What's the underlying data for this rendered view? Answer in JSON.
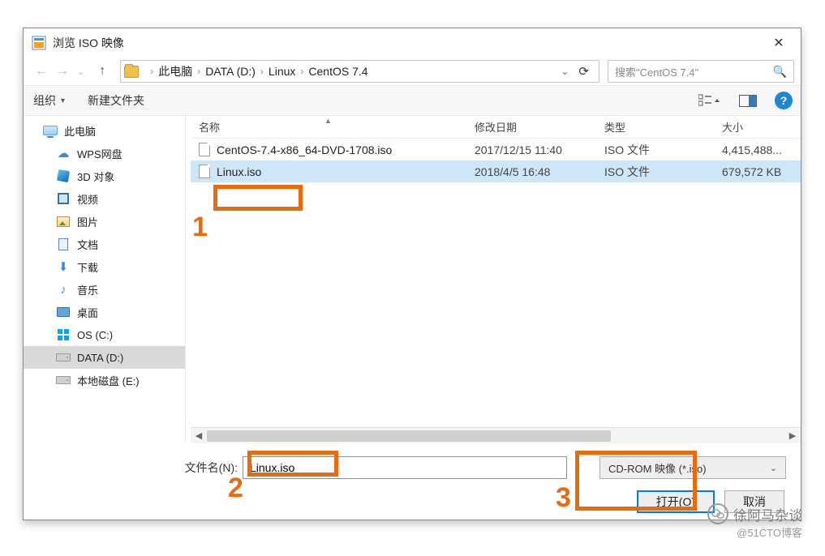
{
  "title": "浏览 ISO 映像",
  "breadcrumb": {
    "parts": [
      "此电脑",
      "DATA (D:)",
      "Linux",
      "CentOS 7.4"
    ]
  },
  "search": {
    "placeholder": "搜索\"CentOS 7.4\""
  },
  "toolbar": {
    "organize": "组织",
    "newfolder": "新建文件夹"
  },
  "columns": {
    "name": "名称",
    "date": "修改日期",
    "type": "类型",
    "size": "大小"
  },
  "sidebar": {
    "thispc": "此电脑",
    "wps": "WPS网盘",
    "d3": "3D 对象",
    "video": "视频",
    "pictures": "图片",
    "docs": "文档",
    "downloads": "下载",
    "music": "音乐",
    "desktop": "桌面",
    "osc": "OS (C:)",
    "datad": "DATA (D:)",
    "locale": "本地磁盘 (E:)"
  },
  "files": [
    {
      "name": "CentOS-7.4-x86_64-DVD-1708.iso",
      "date": "2017/12/15 11:40",
      "type": "ISO 文件",
      "size": "4,415,488..."
    },
    {
      "name": "Linux.iso",
      "date": "2018/4/5 16:48",
      "type": "ISO 文件",
      "size": "679,572 KB"
    }
  ],
  "footer": {
    "fn_label": "文件名(N):",
    "fn_value": "Linux.iso",
    "filter": "CD-ROM 映像 (*.iso)",
    "open": "打开(O)",
    "cancel": "取消"
  },
  "annotations": {
    "n1": "1",
    "n2": "2",
    "n3": "3"
  },
  "watermark": {
    "name": "徐阿马杂谈",
    "sub": "@51CTO博客"
  }
}
